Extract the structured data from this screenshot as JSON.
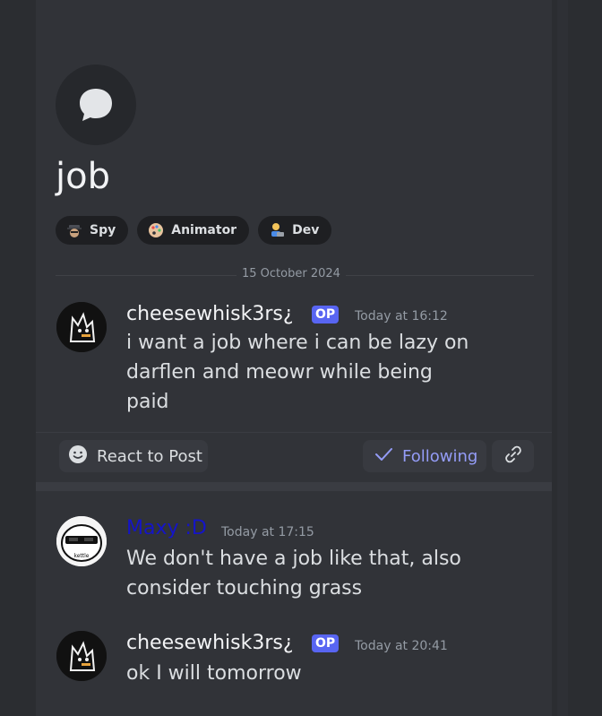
{
  "post": {
    "title": "job",
    "tags": [
      {
        "label": "Spy",
        "icon": "spy-icon"
      },
      {
        "label": "Animator",
        "icon": "palette-icon"
      },
      {
        "label": "Dev",
        "icon": "developer-icon"
      }
    ],
    "date_divider": "15 October 2024",
    "op_message": {
      "author": "cheesewhisk3rs¿",
      "badge": "OP",
      "timestamp": "Today at 16:12",
      "lines": [
        "i want a job where i can be lazy on",
        "darflen and meowr while being",
        "paid"
      ]
    },
    "actions": {
      "react_label": "React to Post",
      "following_label": "Following"
    }
  },
  "replies": [
    {
      "author": "Maxy :D",
      "author_color": "#1414c8",
      "timestamp": "Today at 17:15",
      "lines": [
        "We don't have a job like that, also",
        "consider touching grass"
      ]
    },
    {
      "author": "cheesewhisk3rs¿",
      "badge": "OP",
      "timestamp": "Today at 20:41",
      "lines": [
        "ok I will tomorrow"
      ]
    }
  ],
  "colors": {
    "background": "#313338",
    "accent": "#5865f2",
    "following": "#949cf7"
  }
}
